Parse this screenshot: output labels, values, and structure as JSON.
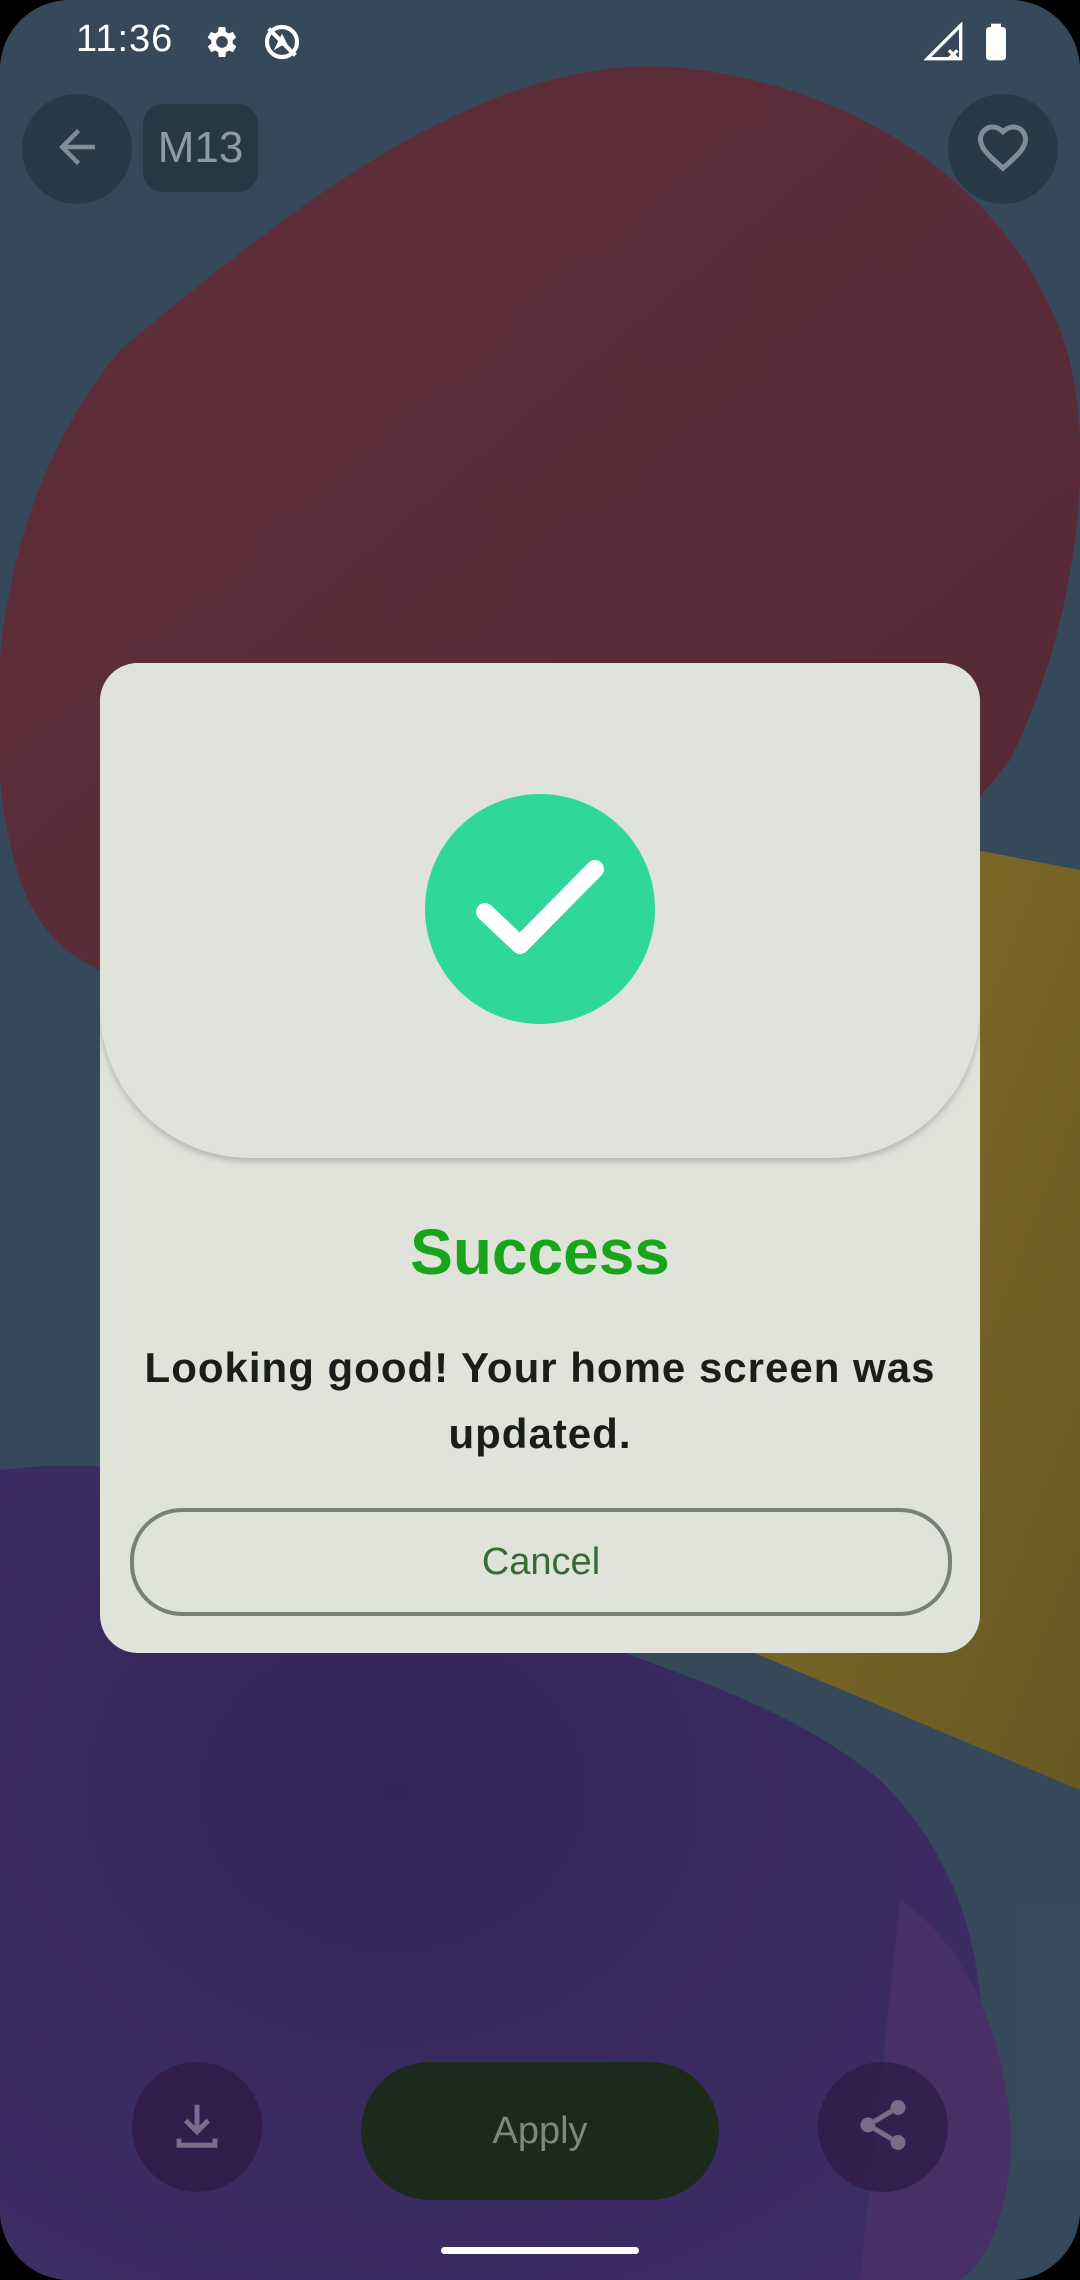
{
  "status_bar": {
    "time": "11:36",
    "icons": [
      "settings-icon",
      "no-location-icon",
      "signal-icon",
      "battery-icon"
    ]
  },
  "top_bar": {
    "back_icon": "arrow-back-icon",
    "chip_label": "M13",
    "favorite_icon": "heart-outline-icon"
  },
  "bottom_bar": {
    "download_icon": "download-icon",
    "apply_label": "Apply",
    "share_icon": "share-icon"
  },
  "dialog": {
    "icon": "checkmark-icon",
    "title": "Success",
    "message": "Looking good! Your home screen was updated.",
    "cancel_label": "Cancel",
    "colors": {
      "title": "#18a51b",
      "circle": "#2fd899",
      "background": "#dfe3da",
      "button_text": "#3a6a33"
    }
  }
}
